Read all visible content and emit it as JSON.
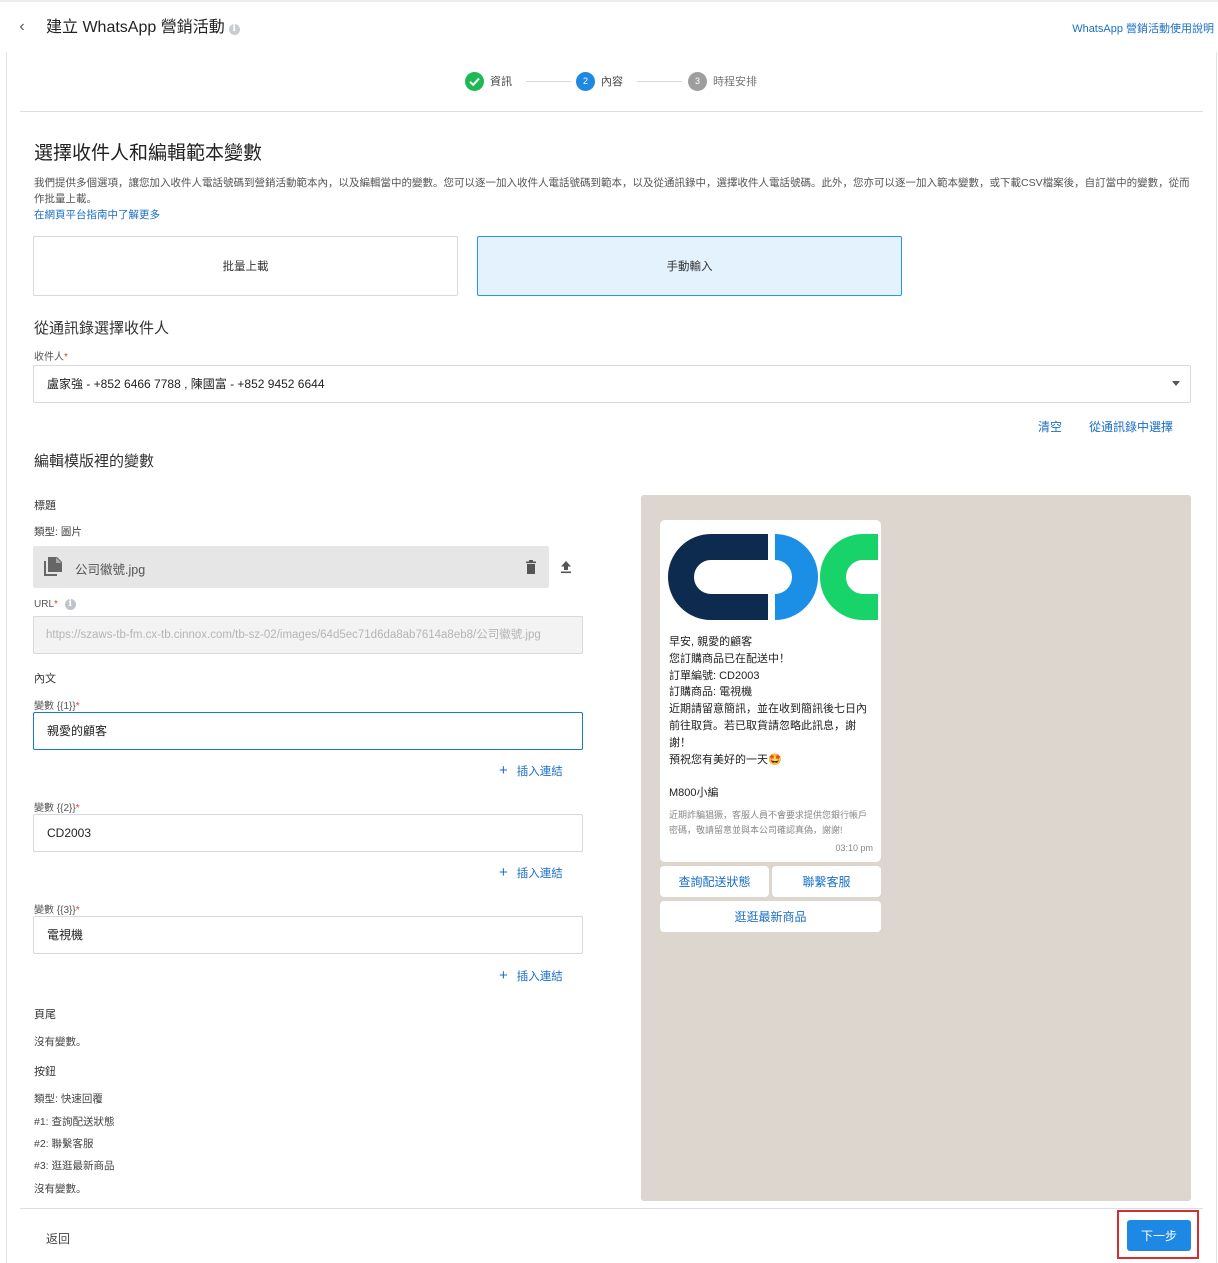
{
  "header": {
    "title": "建立 WhatsApp 營銷活動",
    "info_icon": "info-icon",
    "help_link": "WhatsApp 營銷活動使用說明"
  },
  "stepper": {
    "steps": [
      {
        "label": "資訊",
        "state": "done"
      },
      {
        "label": "內容",
        "number": "2",
        "state": "active"
      },
      {
        "label": "時程安排",
        "number": "3",
        "state": "pending"
      }
    ],
    "colors": {
      "done": "#1db954",
      "active": "#1e88e5",
      "pending": "#9e9e9e"
    }
  },
  "recipients": {
    "title": "選擇收件人和編輯範本變數",
    "description": "我們提供多個選項，讓您加入收件人電話號碼到營銷活動範本內，以及編輯當中的變數。您可以逐一加入收件人電話號碼到範本，以及從通訊錄中，選擇收件人電話號碼。此外，您亦可以逐一加入範本變數，或下載CSV檔案後，自訂當中的變數，從而作批量上載。",
    "learn_more": "在網頁平台指南中了解更多",
    "mode_bulk": "批量上載",
    "mode_manual": "手動輸入",
    "contacts_title": "從通訊錄選擇收件人",
    "field_label": "收件人",
    "selected_value": "盧家強 - +852 6466 7788 , 陳國富 - +852 9452 6644",
    "clear": "清空",
    "pick_from_contacts": "從通訊錄中選擇"
  },
  "template": {
    "title": "編輯模版裡的變數",
    "header_label": "標題",
    "type_label": "類型: 圖片",
    "file_name": "公司徽號.jpg",
    "url_label": "URL",
    "url_value": "https://szaws-tb-fm.cx-tb.cinnox.com/tb-sz-02/images/64d5ec71d6da8ab7614a8eb8/公司徽號.jpg",
    "body_label": "內文",
    "variables": [
      {
        "label": "變數 {{1}}",
        "value": "親愛的顧客"
      },
      {
        "label": "變數 {{2}}",
        "value": "CD2003"
      },
      {
        "label": "變數 {{3}}",
        "value": "電視機"
      }
    ],
    "insert_link": "插入連結",
    "footer_label": "頁尾",
    "no_variables": "沒有變數。",
    "buttons_label": "按鈕",
    "buttons_type": "類型: 快速回覆",
    "button_lines": [
      "#1: 查詢配送狀態",
      "#2: 聯繫客服",
      "#3: 逛逛最新商品"
    ],
    "buttons_no_variables": "沒有變數。"
  },
  "preview": {
    "message_lines": [
      "早安, 親愛的顧客",
      "您訂購商品已在配送中！",
      "訂單編號: CD2003",
      "訂購商品: 電視機",
      "近期請留意簡訊，並在收到簡訊後七日內前往取貨。若已取貨請忽略此訊息，謝謝！",
      "預祝您有美好的一天🤩"
    ],
    "signature": "M800小編",
    "footer_note": "近期詐騙猖獗，客服人員不會要求提供您銀行帳戶密碼，敬請留意並與本公司確認真偽，謝謝!",
    "time": "03:10 pm",
    "quick_replies": [
      "查詢配送狀態",
      "聯繫客服",
      "逛逛最新商品"
    ],
    "logo_colors": {
      "dark": "#0d2a4f",
      "blue": "#1b8fe6",
      "green": "#18d36a"
    }
  },
  "footer": {
    "back": "返回",
    "next": "下一步"
  }
}
